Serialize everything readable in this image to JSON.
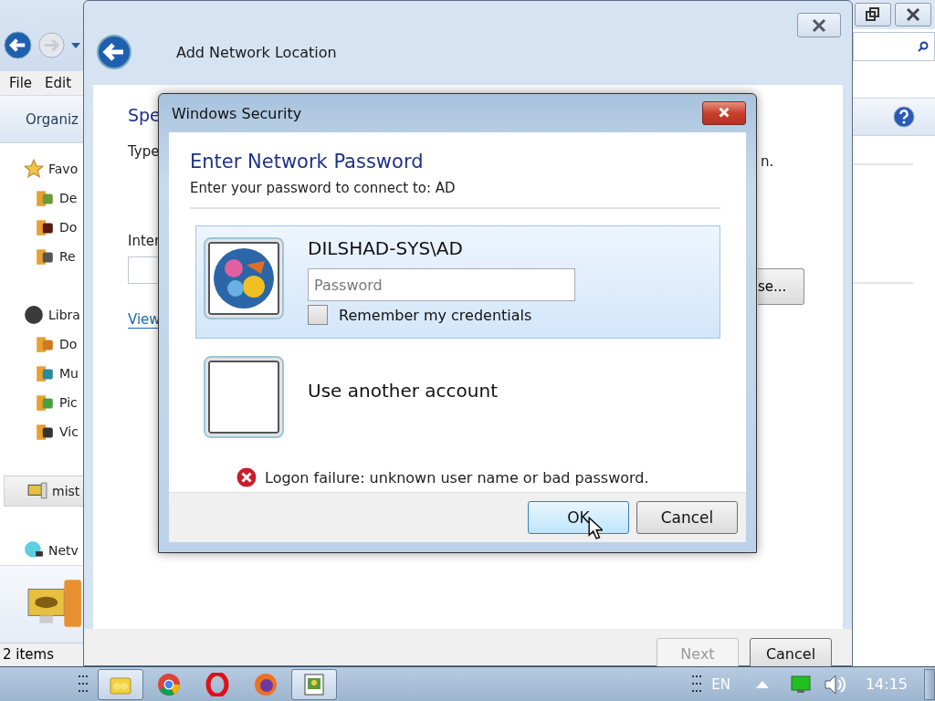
{
  "explorer": {
    "menu": [
      "File",
      "Edit"
    ],
    "toolbar": {
      "organize": "Organiz"
    },
    "sidebar": [
      {
        "label": "Favo",
        "kind": "star",
        "selected": false,
        "children": [
          {
            "label": "De",
            "kind": "desktop"
          },
          {
            "label": "Do",
            "kind": "downloads"
          },
          {
            "label": "Re",
            "kind": "recent"
          }
        ]
      },
      {
        "label": "Libra",
        "kind": "library",
        "selected": false,
        "children": [
          {
            "label": "Do",
            "kind": "documents"
          },
          {
            "label": "Mu",
            "kind": "music"
          },
          {
            "label": "Pic",
            "kind": "pictures"
          },
          {
            "label": "Vic",
            "kind": "videos"
          }
        ]
      },
      {
        "label": "mist",
        "kind": "computer",
        "selected": true
      },
      {
        "label": "Netv",
        "kind": "network",
        "selected": false
      }
    ],
    "status": "2 items"
  },
  "wizard": {
    "title": "Add Network Location",
    "heading": "Spe",
    "instruction_start": "Type",
    "instruction_end": "n.",
    "field_label": "Inter",
    "browse_button": "se...",
    "link": "View",
    "buttons": [
      {
        "label": "Next",
        "disabled": true
      },
      {
        "label": "Cancel",
        "disabled": false
      }
    ]
  },
  "dialog": {
    "title": "Windows Security",
    "heading": "Enter Network Password",
    "subtitle": "Enter your password to connect to: AD",
    "accounts": [
      {
        "kind": "user",
        "name": "DILSHAD-SYS\\AD",
        "selected": true,
        "password_placeholder": "Password",
        "remember": {
          "label": "Remember my credentials",
          "checked": false
        }
      },
      {
        "kind": "other",
        "name": "Use another account",
        "selected": false
      }
    ],
    "error": "Logon failure: unknown user name or bad password.",
    "buttons": [
      {
        "label": "OK",
        "default": true
      },
      {
        "label": "Cancel",
        "default": false
      }
    ]
  },
  "taskbar": {
    "apps": [
      {
        "kind": "folders",
        "active": true
      },
      {
        "kind": "chrome",
        "active": false
      },
      {
        "kind": "opera",
        "active": false
      },
      {
        "kind": "firefox",
        "active": false
      },
      {
        "kind": "viewer",
        "active": true
      }
    ],
    "language": "EN",
    "clock": "14:15"
  }
}
